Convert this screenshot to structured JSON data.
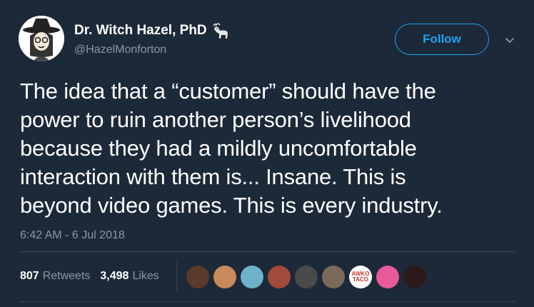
{
  "author": {
    "display_name": "Dr. Witch Hazel, PhD",
    "handle": "@HazelMonforton",
    "avatar_icon": "witch-hat-portrait",
    "badge_icon": "goat-icon"
  },
  "follow_label": "Follow",
  "tweet": {
    "lines": [
      "The idea that a “customer” should have the",
      "power to ruin another person’s livelihood",
      "because they had a mildly uncomfortable",
      "interaction with them is... Insane. This is",
      "beyond video games. This is every industry."
    ],
    "timestamp": "6:42 AM - 6 Jul 2018"
  },
  "stats": {
    "retweets_count": "807",
    "retweets_label": "Retweets",
    "likes_count": "3,498",
    "likes_label": "Likes"
  },
  "likers": [
    {
      "color": "#5a3a2a",
      "text": ""
    },
    {
      "color": "#c98a5a",
      "text": ""
    },
    {
      "color": "#6fb3c9",
      "text": ""
    },
    {
      "color": "#a34a3a",
      "text": ""
    },
    {
      "color": "#4a4a4a",
      "text": ""
    },
    {
      "color": "#7a6a5a",
      "text": ""
    },
    {
      "color": "#ffffff",
      "text": "AWKO TACO"
    },
    {
      "color": "#e85a9a",
      "text": ""
    },
    {
      "color": "#2a1a1a",
      "text": ""
    }
  ],
  "colors": {
    "background": "#1c2938",
    "accent": "#1da1f2",
    "secondary_text": "#8899a6"
  }
}
